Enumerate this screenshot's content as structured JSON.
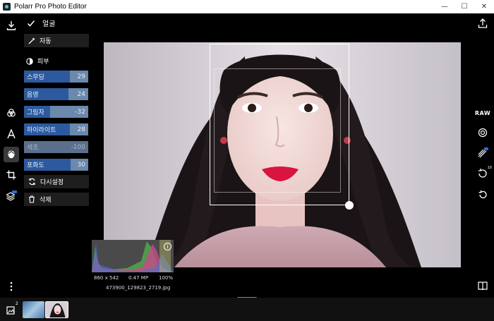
{
  "window": {
    "title": "Polarr Pro Photo Editor",
    "minimize": "—",
    "maximize": "☐",
    "close": "✕"
  },
  "panel": {
    "header_label": "얼굴",
    "auto_label": "자동",
    "section_title": "피부",
    "sliders": [
      {
        "label": "스무딩",
        "value": "29",
        "amount": 29
      },
      {
        "label": "음영",
        "value": "24",
        "amount": 24
      },
      {
        "label": "그림자",
        "value": "-32",
        "amount": -32
      },
      {
        "label": "하이라이트",
        "value": "28",
        "amount": 28
      },
      {
        "label": "색조",
        "value": "-100",
        "amount": -100
      },
      {
        "label": "포화도",
        "value": "30",
        "amount": 30
      }
    ],
    "reset_label": "다시설정",
    "delete_label": "삭제"
  },
  "left_tools": [
    "download-icon",
    "filters-icon",
    "text-icon",
    "face-icon",
    "crop-icon",
    "layers-icon",
    "more-icon"
  ],
  "right_tools": {
    "raw_label": "RAW",
    "history_badge": "10"
  },
  "image_info": {
    "dimensions": "860 x 542",
    "megapixels": "0.47 MP",
    "zoom": "100%",
    "filename": "473900_129823_2719.jpg"
  },
  "filmstrip": {
    "count_badge": "2"
  },
  "colors": {
    "accent": "#2d5a9e",
    "slider_bg": "#6b88ad",
    "panel_bg": "#1e1e1e",
    "background": "#000000"
  }
}
